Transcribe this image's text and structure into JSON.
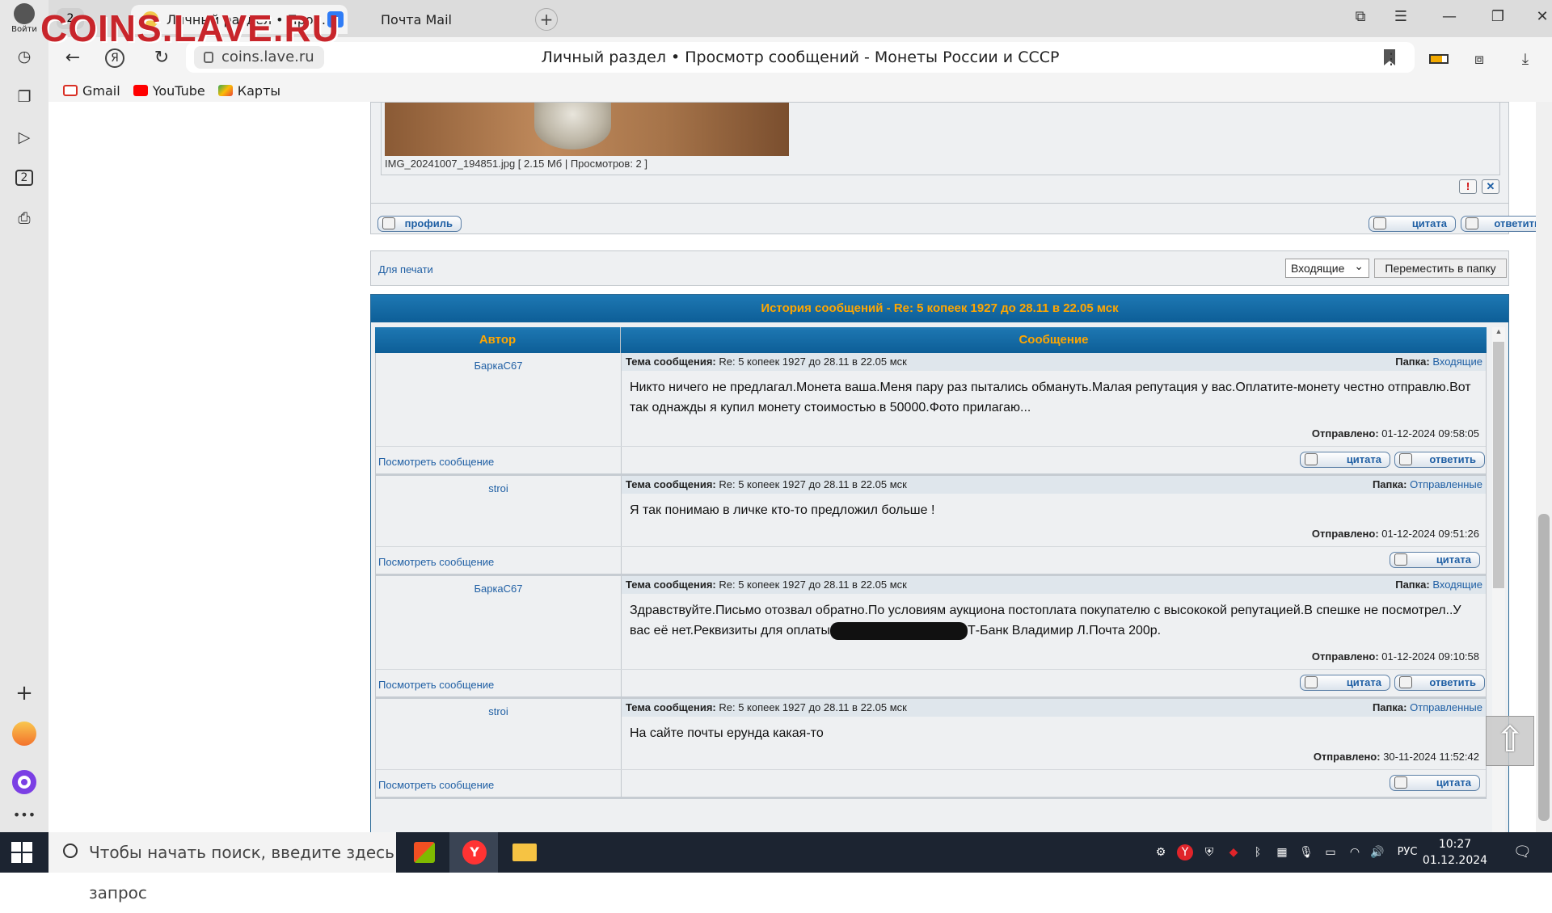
{
  "watermark": "COINS.LAVE.RU",
  "browser": {
    "login_label": "Войти",
    "tab_count": "2",
    "active_tab": "Личный раздел • Про...",
    "mail_tab": "Почта Mail",
    "domain": "coins.lave.ru",
    "page_title": "Личный раздел • Просмотр сообщений - Монеты России и СССР",
    "bookmarks": [
      "Gmail",
      "YouTube",
      "Карты"
    ],
    "rail_badge": "2"
  },
  "attachment": {
    "caption": "IMG_20241007_194851.jpg [ 2.15 Мб | Просмотров: 2 ]"
  },
  "post_buttons": {
    "profile": "профиль",
    "quote": "цитата",
    "reply": "ответить"
  },
  "print_row": {
    "print_link": "Для печати",
    "folder_select": "Входящие",
    "move_button": "Переместить в папку"
  },
  "history": {
    "title": "История сообщений - Re: 5 копеек 1927 до 28.11 в 22.05 мск",
    "col_author": "Автор",
    "col_message": "Сообщение",
    "subject_label": "Тема сообщения:",
    "folder_label": "Папка:",
    "sent_label": "Отправлено:",
    "view_link": "Посмотреть сообщение",
    "messages": [
      {
        "author": "БаркаС67",
        "subject": "Re: 5 копеек 1927 до 28.11 в 22.05 мск",
        "folder": "Входящие",
        "text": "Никто ничего не предлагал.Монета ваша.Меня пару раз пытались обмануть.Малая репутация у вас.Оплатите-монету честно отправлю.Вот так однажды я купил монету стоимостью в 50000.Фото прилагаю...",
        "sent": "01-12-2024 09:58:05"
      },
      {
        "author": "stroi",
        "subject": "Re: 5 копеек 1927 до 28.11 в 22.05 мск",
        "folder": "Отправленные",
        "text": "Я так понимаю в личке кто-то предложил больше !",
        "sent": "01-12-2024 09:51:26"
      },
      {
        "author": "БаркаС67",
        "subject": "Re: 5 копеек 1927 до 28.11 в 22.05 мск",
        "folder": "Входящие",
        "text_before": "Здравствуйте.Письмо отозвал обратно.По условиям аукциона постоплата покупателю с высококой репутацией.В спешке не посмотрел..У вас её нет.Реквизиты для оплаты",
        "text_after": "Т-Банк Владимир Л.Почта 200р.",
        "sent": "01-12-2024 09:10:58"
      },
      {
        "author": "stroi",
        "subject": "Re: 5 копеек 1927 до 28.11 в 22.05 мск",
        "folder": "Отправленные",
        "text": "На сайте почты ерунда какая-то",
        "sent": "30-11-2024 11:52:42"
      }
    ]
  },
  "taskbar": {
    "search_placeholder": "Чтобы начать поиск, введите здесь запрос",
    "lang": "РУС",
    "time": "10:27",
    "date": "01.12.2024"
  },
  "colors": {
    "forum_header": "#0d5e97",
    "header_text": "#ffa600",
    "link": "#1f5fa4",
    "watermark": "#c8252b"
  }
}
